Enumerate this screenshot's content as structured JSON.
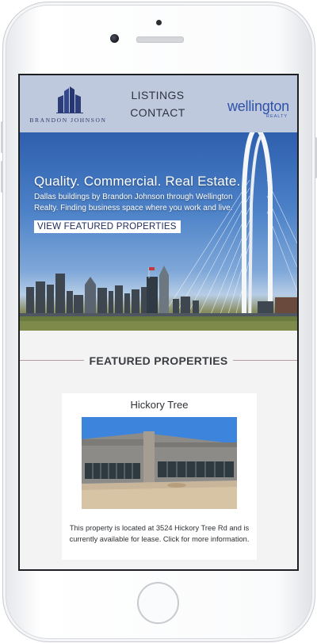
{
  "header": {
    "logo_left_text": "BRANDON JOHNSON",
    "nav": [
      "LISTINGS",
      "CONTACT"
    ],
    "logo_right_word": "wellington",
    "logo_right_sub": "REALTY"
  },
  "hero": {
    "title": "Quality. Commercial. Real Estate.",
    "subtitle": "Dallas buildings by Brandon Johnson through Wellington Realty. Finding business space where you work and live.",
    "cta": "VIEW FEATURED PROPERTIES"
  },
  "featured": {
    "heading": "FEATURED PROPERTIES",
    "card": {
      "title": "Hickory Tree",
      "description": "This property is located at 3524 Hickory Tree Rd and is currently available for lease. Click for more information."
    }
  },
  "colors": {
    "header_bg": "#bfc9de",
    "brand_blue": "#2f52a8",
    "logo_navy": "#2c3a66"
  }
}
